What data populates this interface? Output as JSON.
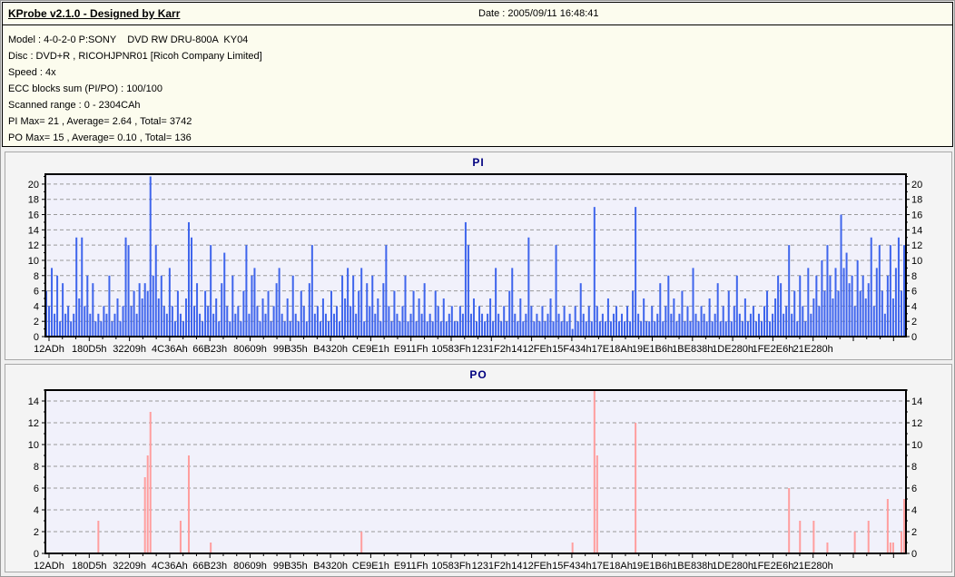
{
  "header": {
    "app_title": "KProbe v2.1.0 - Designed by Karr",
    "date_label": "Date : 2005/09/11 16:48:41"
  },
  "info_panel": {
    "lines": [
      "Model : 4-0-2-0 P:SONY    DVD RW DRU-800A  KY04",
      "Disc : DVD+R , RICOHJPNR01 [Ricoh Company Limited]",
      "Speed : 4x",
      "ECC blocks sum (PI/PO) : 100/100",
      "Scanned range : 0 - 2304CAh",
      "PI Max= 21 , Average= 2.64 , Total= 3742",
      "PO Max= 15 , Average= 0.10 , Total= 136"
    ]
  },
  "colors": {
    "pi_bar": "#3F65EC",
    "po_bar": "#FF9E9E",
    "plot_bg": "#F1F1FB",
    "grid": "#999999",
    "title": "#000080",
    "panel_bg": "#F4F4F4",
    "top_panel_bg": "#FCFCEE"
  },
  "chart_data": [
    {
      "type": "bar",
      "title": "PI",
      "ylim": [
        0,
        21.3
      ],
      "yticks": [
        0,
        2,
        4,
        6,
        8,
        10,
        12,
        14,
        16,
        18,
        20
      ],
      "grid": true,
      "x_labels": [
        "12ADh",
        "180D5h",
        "32209h",
        "4C36Ah",
        "66B23h",
        "80609h",
        "99B35h",
        "B4320h",
        "CE9E1h",
        "E911Fh",
        "10583Fh",
        "1231F2h",
        "1412FEh",
        "15F434h",
        "17E18Ah",
        "19E1B6h",
        "1BE838h",
        "1DE280h",
        "1FE2E6h",
        "21E280h"
      ],
      "stats": {
        "max": 21,
        "average": 2.64,
        "total": 3742
      },
      "values": [
        6,
        4,
        9,
        3,
        8,
        2,
        7,
        3,
        4,
        2,
        3,
        13,
        5,
        13,
        4,
        8,
        3,
        7,
        2,
        3,
        2,
        4,
        3,
        8,
        2,
        3,
        5,
        2,
        4,
        13,
        12,
        4,
        6,
        3,
        7,
        5,
        7,
        6,
        21,
        8,
        12,
        5,
        8,
        4,
        3,
        9,
        4,
        2,
        6,
        3,
        2,
        5,
        15,
        13,
        4,
        7,
        3,
        2,
        6,
        4,
        12,
        3,
        5,
        2,
        7,
        11,
        4,
        2,
        8,
        3,
        4,
        2,
        6,
        12,
        3,
        8,
        9,
        4,
        2,
        5,
        3,
        6,
        2,
        4,
        7,
        9,
        3,
        2,
        5,
        2,
        8,
        3,
        2,
        6,
        4,
        2,
        7,
        12,
        3,
        4,
        2,
        5,
        3,
        2,
        6,
        3,
        4,
        2,
        8,
        5,
        9,
        4,
        8,
        3,
        6,
        9,
        2,
        7,
        4,
        8,
        3,
        5,
        2,
        7,
        12,
        4,
        2,
        6,
        3,
        2,
        4,
        8,
        2,
        3,
        6,
        2,
        5,
        3,
        7,
        2,
        3,
        2,
        6,
        4,
        2,
        5,
        2,
        3,
        4,
        2,
        2,
        4,
        3,
        15,
        12,
        3,
        5,
        2,
        4,
        3,
        2,
        3,
        5,
        2,
        9,
        3,
        2,
        4,
        2,
        6,
        9,
        3,
        2,
        5,
        2,
        3,
        13,
        4,
        2,
        3,
        2,
        4,
        2,
        3,
        5,
        2,
        12,
        3,
        2,
        4,
        2,
        3,
        1,
        4,
        2,
        7,
        3,
        2,
        4,
        2,
        17,
        4,
        2,
        3,
        2,
        5,
        2,
        3,
        4,
        2,
        3,
        2,
        4,
        2,
        6,
        17,
        3,
        2,
        5,
        2,
        2,
        4,
        2,
        3,
        7,
        2,
        4,
        8,
        3,
        5,
        2,
        3,
        6,
        2,
        4,
        2,
        9,
        3,
        2,
        4,
        3,
        2,
        5,
        2,
        3,
        7,
        2,
        4,
        2,
        6,
        2,
        4,
        8,
        3,
        2,
        5,
        2,
        3,
        4,
        2,
        3,
        2,
        4,
        6,
        2,
        3,
        5,
        8,
        7,
        3,
        4,
        12,
        3,
        6,
        2,
        8,
        4,
        2,
        9,
        3,
        5,
        8,
        4,
        10,
        6,
        12,
        8,
        5,
        9,
        6,
        16,
        9,
        11,
        7,
        8,
        4,
        10,
        6,
        8,
        5,
        7,
        13,
        4,
        9,
        12,
        6,
        3,
        8,
        12,
        5,
        9,
        13,
        6,
        12
      ]
    },
    {
      "type": "bar",
      "title": "PO",
      "ylim": [
        0,
        15
      ],
      "yticks": [
        0,
        2,
        4,
        6,
        8,
        10,
        12,
        14
      ],
      "grid": true,
      "x_labels": [
        "12ADh",
        "180D5h",
        "32209h",
        "4C36Ah",
        "66B23h",
        "80609h",
        "99B35h",
        "B4320h",
        "CE9E1h",
        "E911Fh",
        "10583Fh",
        "1231F2h",
        "1412FEh",
        "15F434h",
        "17E18Ah",
        "19E1B6h",
        "1BE838h",
        "1DE280h",
        "1FE2E6h",
        "21E280h"
      ],
      "stats": {
        "max": 15,
        "average": 0.1,
        "total": 136
      },
      "n_slots": 314,
      "points": [
        [
          19,
          3
        ],
        [
          36,
          7
        ],
        [
          37,
          9
        ],
        [
          38,
          13
        ],
        [
          49,
          3
        ],
        [
          52,
          9
        ],
        [
          60,
          1
        ],
        [
          115,
          2
        ],
        [
          192,
          1
        ],
        [
          200,
          15
        ],
        [
          201,
          9
        ],
        [
          215,
          12
        ],
        [
          271,
          6
        ],
        [
          275,
          3
        ],
        [
          280,
          3
        ],
        [
          285,
          1
        ],
        [
          295,
          2
        ],
        [
          300,
          3
        ],
        [
          307,
          5
        ],
        [
          308,
          1
        ],
        [
          309,
          1
        ],
        [
          312,
          2
        ],
        [
          313,
          5
        ]
      ]
    }
  ]
}
